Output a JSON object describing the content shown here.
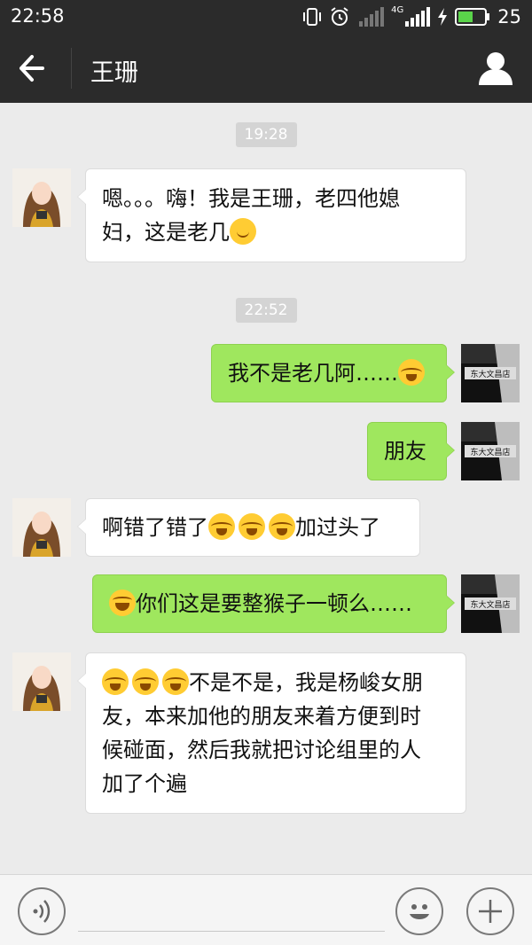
{
  "status_bar": {
    "time": "22:58",
    "network": "4G",
    "battery": "25"
  },
  "header": {
    "title": "王珊"
  },
  "messages": [
    {
      "type": "timestamp",
      "text": "19:28"
    },
    {
      "type": "received",
      "lines": [
        "嗯。。。嗨！我是王珊，老四他媳",
        "妇，这是老几"
      ],
      "emojis": [
        "smile"
      ]
    },
    {
      "type": "timestamp",
      "text": "22:52"
    },
    {
      "type": "sent",
      "text": "我不是老几阿……",
      "emojis": [
        "cry"
      ]
    },
    {
      "type": "sent",
      "text": "朋友"
    },
    {
      "type": "received",
      "text_before": "啊错了错了",
      "text_after": "加过头了",
      "emojis": [
        "cry",
        "cry",
        "cry"
      ]
    },
    {
      "type": "sent",
      "text": "你们这是要整猴子一顿么……",
      "emojis": [
        "laugh"
      ]
    },
    {
      "type": "received",
      "lines": [
        "不是不是，我是杨峻女朋",
        "友，本来加他的朋友来着方便到时",
        "候碰面，然后我就把讨论组里的人",
        "加了个遍"
      ],
      "emojis": [
        "cry",
        "cry",
        "cry"
      ]
    }
  ],
  "sent_avatar_text": "东大文昌店",
  "colors": {
    "header_bg": "#2b2b2b",
    "chat_bg": "#ebebeb",
    "sent_bubble": "#9fe75e",
    "received_bubble": "#ffffff"
  },
  "input_bar": {
    "placeholder": ""
  }
}
